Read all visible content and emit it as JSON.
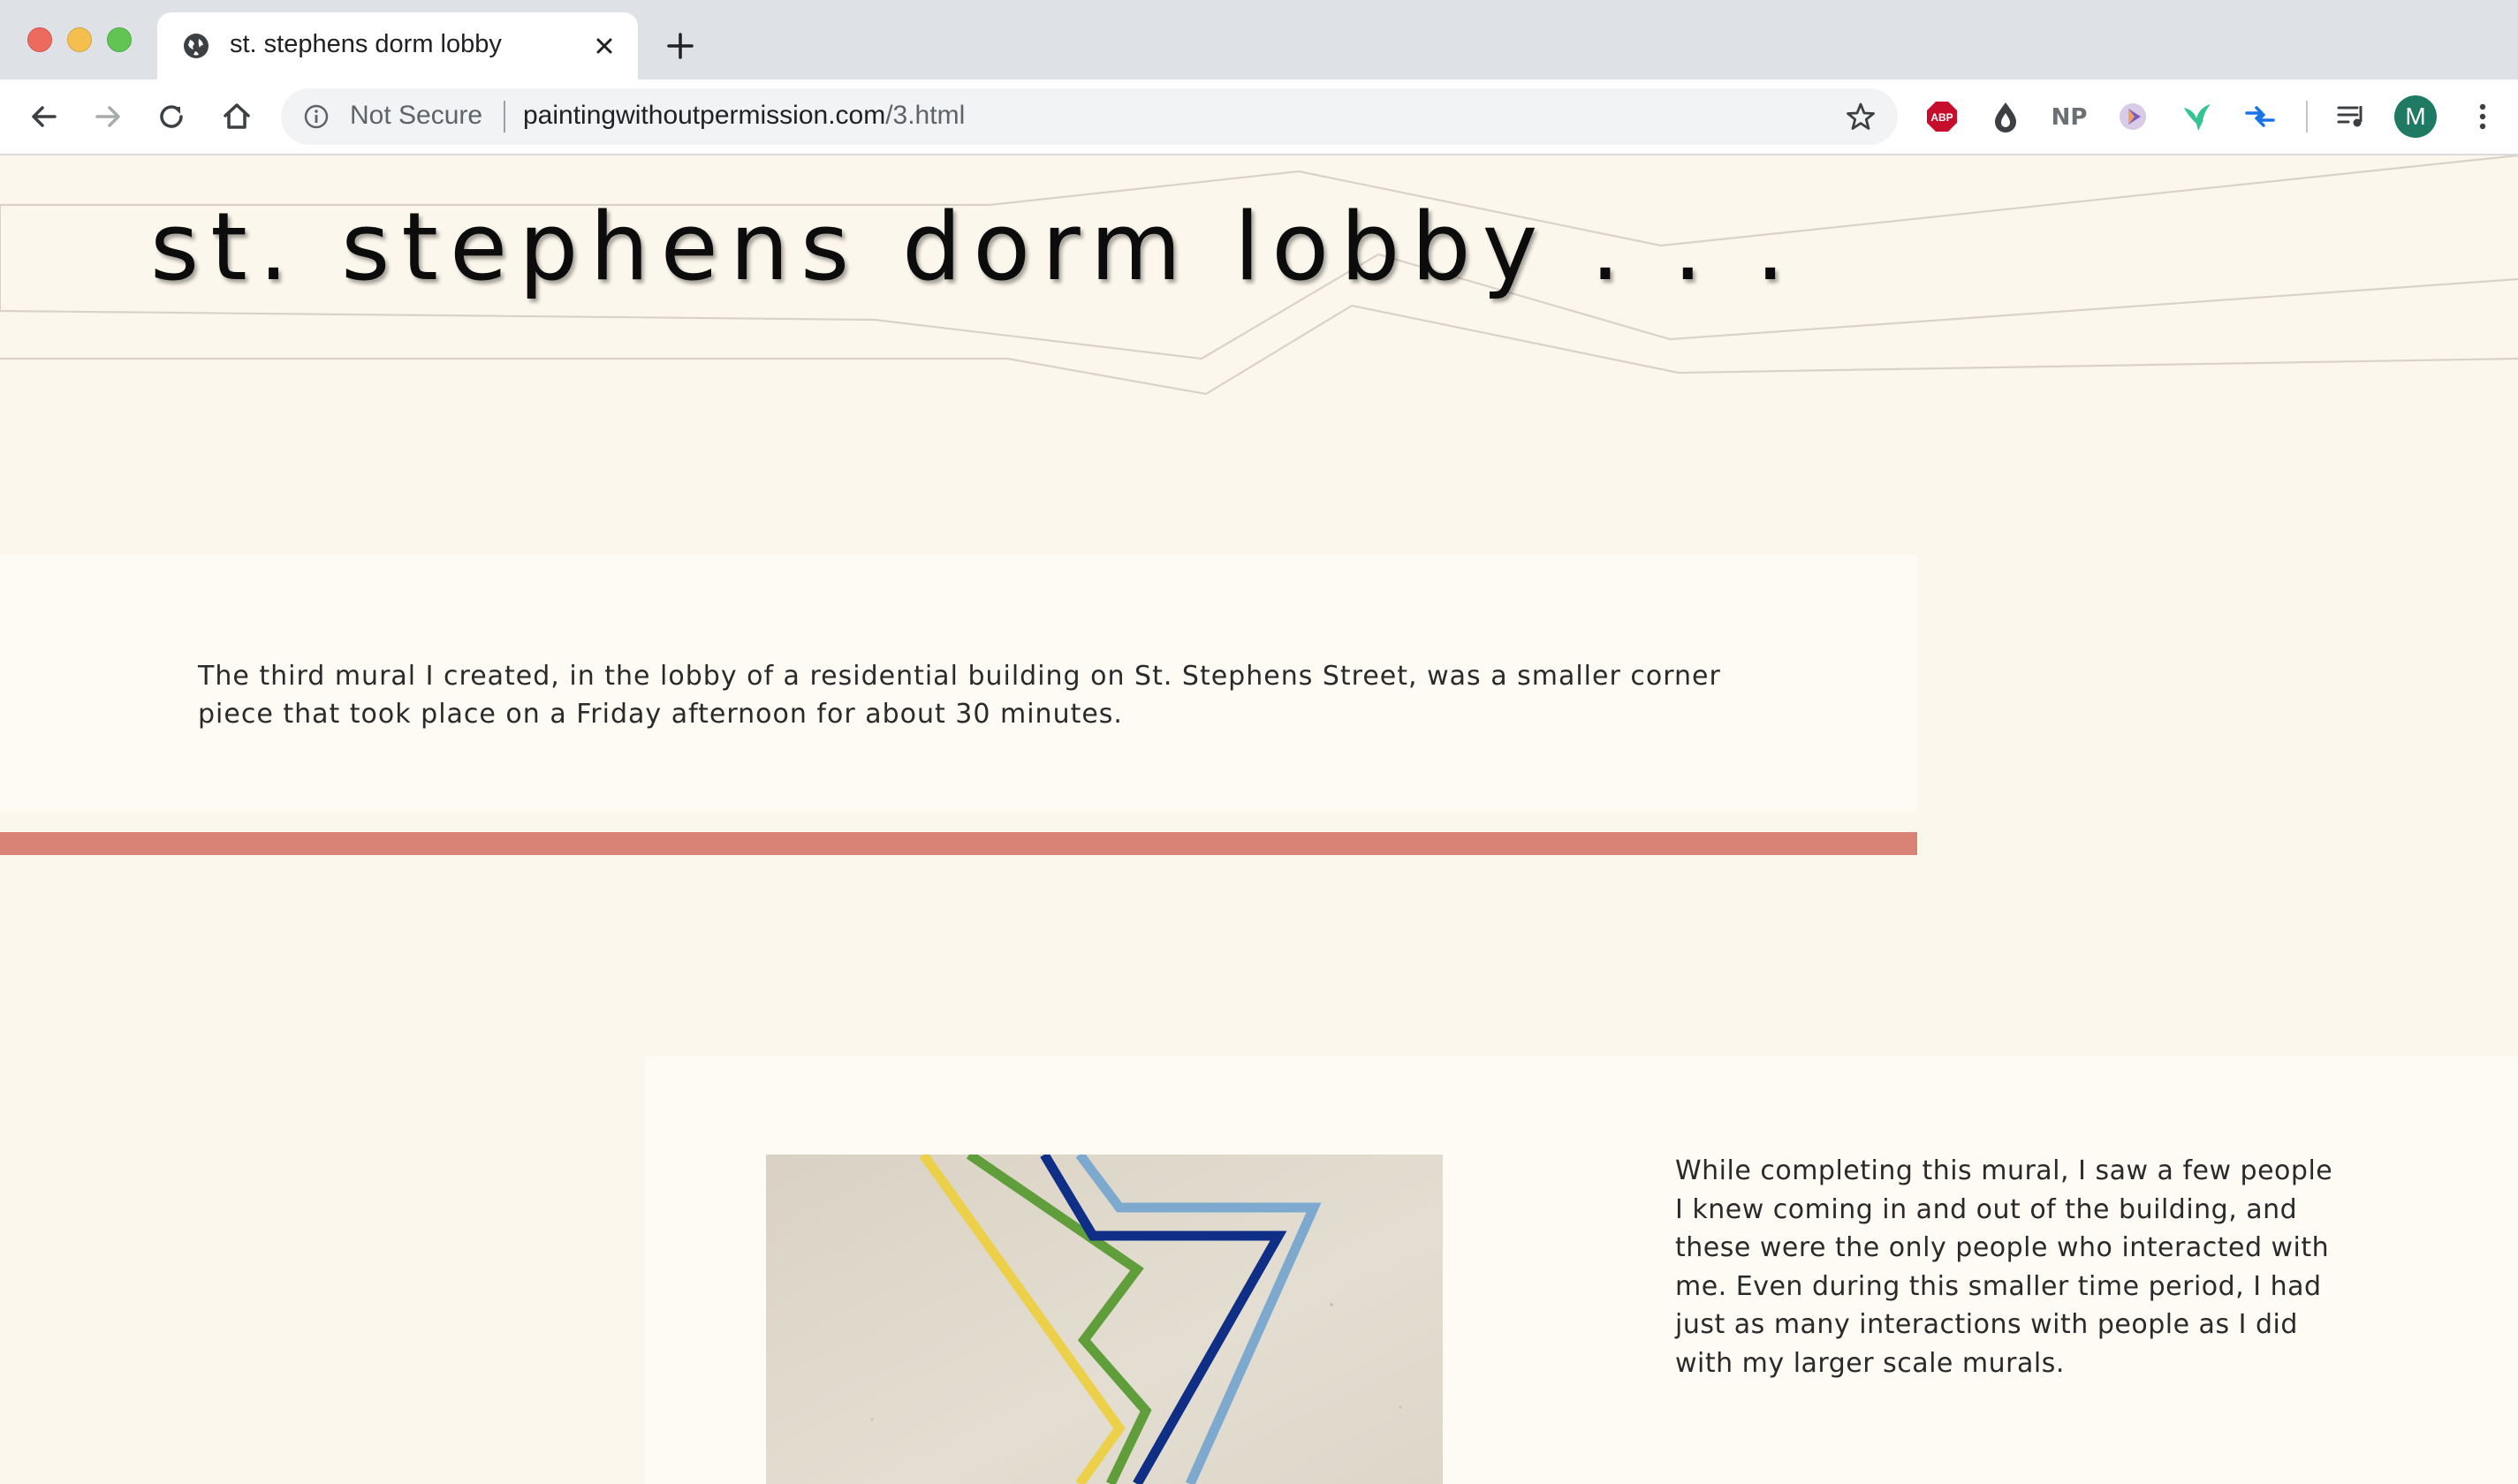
{
  "browser": {
    "tab_title": "st. stephens dorm lobby",
    "security_label": "Not Secure",
    "url_domain": "paintingwithoutpermission.com",
    "url_path": "/3.html",
    "profile_initial": "M",
    "extensions": [
      "adblock-plus-icon",
      "drop-icon",
      "np-icon",
      "play-icon",
      "bird-icon",
      "arrows-icon"
    ],
    "extension_np_label": "NP",
    "extension_abp_label": "ABP",
    "colors": {
      "tab_strip": "#dee1e6",
      "profile": "#1e7a63"
    }
  },
  "page": {
    "heading": "st. stephens dorm lobby . . .",
    "intro": "The third mural I created, in the lobby of a residential building on St. Stephens Street, was a smaller corner piece that took place on a Friday afternoon for about 30 minutes.",
    "caption": "While completing this mural, I saw a few people I knew coming in and out of the building, and these were the only people who interacted with me. Even during this smaller time period, I had just as many interactions with people as I did with my larger scale murals.",
    "colors": {
      "background": "#fcf7ec",
      "panel": "#fefbf5",
      "accent_bar": "#d98276",
      "mural_yellow": "#ecd04a",
      "mural_green": "#5f9e3a",
      "mural_navy": "#0f2f86",
      "mural_light_blue": "#7ea9cf"
    }
  }
}
